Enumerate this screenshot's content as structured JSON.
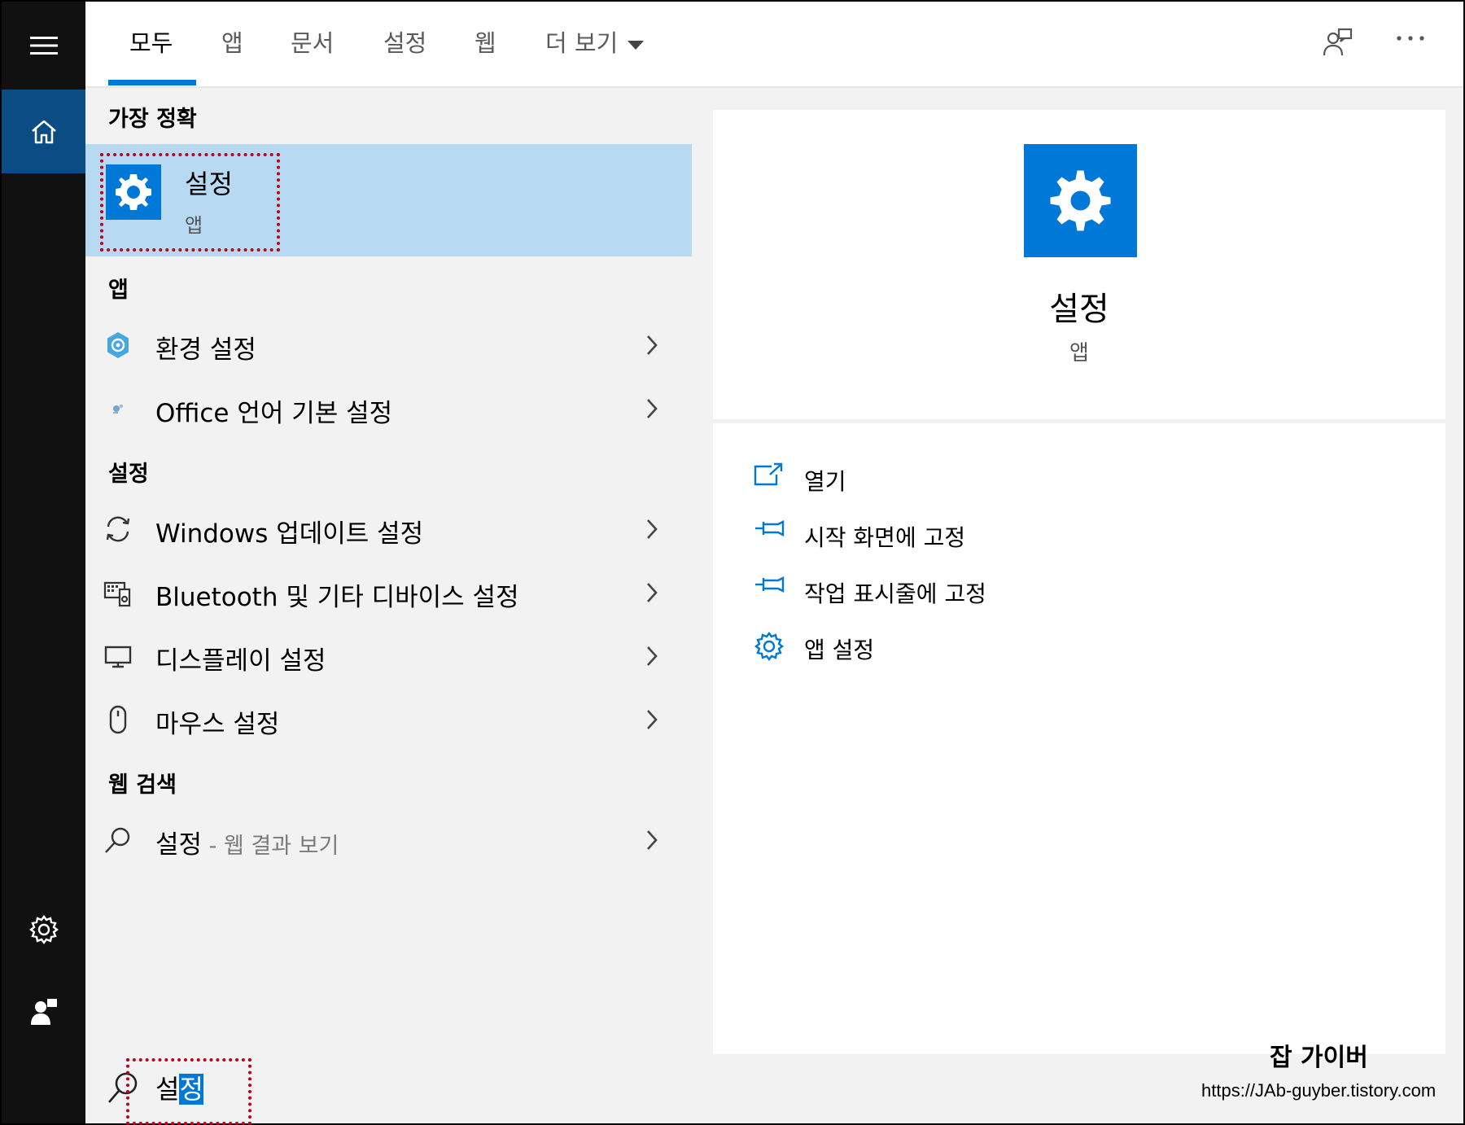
{
  "tabs": {
    "items": [
      {
        "label": "모두",
        "active": true
      },
      {
        "label": "앱"
      },
      {
        "label": "문서"
      },
      {
        "label": "설정"
      },
      {
        "label": "웹"
      },
      {
        "label": "더 보기"
      }
    ]
  },
  "icons": {
    "menu": "hamburger-icon",
    "home": "home-icon",
    "settings": "gear-icon",
    "user": "user-icon",
    "feedback": "feedback-icon",
    "more": "ellipsis-icon"
  },
  "best_match": {
    "section": "가장 정확",
    "title": "설정",
    "subtitle": "앱"
  },
  "apps": {
    "section": "앱",
    "items": [
      {
        "label": "환경 설정"
      },
      {
        "label": "Office 언어 기본 설정"
      }
    ]
  },
  "settings": {
    "section": "설정",
    "items": [
      {
        "label": "Windows 업데이트 설정"
      },
      {
        "label": "Bluetooth 및 기타 디바이스 설정"
      },
      {
        "label": "디스플레이 설정"
      },
      {
        "label": "마우스 설정"
      }
    ]
  },
  "web": {
    "section": "웹 검색",
    "item_label": "설정",
    "item_suffix": " - 웹 결과 보기"
  },
  "preview": {
    "title": "설정",
    "subtitle": "앱",
    "actions": [
      {
        "label": "열기",
        "icon": "open-icon"
      },
      {
        "label": "시작 화면에 고정",
        "icon": "pin-icon"
      },
      {
        "label": "작업 표시줄에 고정",
        "icon": "pin-icon"
      },
      {
        "label": "앱 설정",
        "icon": "gear-icon"
      }
    ]
  },
  "search": {
    "typed": "설",
    "selected": "정"
  },
  "watermark": {
    "title": "잡 가이버",
    "url": "https://JAb-guyber.tistory.com"
  },
  "colors": {
    "accent": "#0078d7",
    "highlight": "#b8d9f2",
    "rail": "#111111",
    "rail_active": "#0b4c84",
    "annotation": "#c0001a"
  }
}
